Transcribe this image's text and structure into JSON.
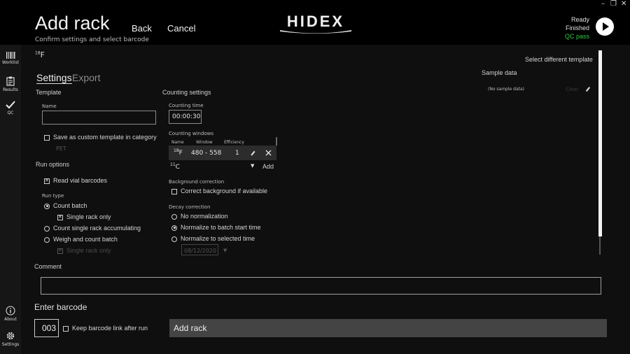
{
  "header": {
    "title": "Add rack",
    "subtitle": "Confirm settings and select barcode",
    "back_label": "Back",
    "cancel_label": "Cancel",
    "logo_text": "HIDEX",
    "status": {
      "ready": "Ready",
      "finished": "Finished",
      "qc": "QC pass",
      "qc_color": "#2ecc40"
    }
  },
  "window_controls": {
    "minimize": "–",
    "restore": "❐",
    "close": "✕"
  },
  "sidebar": {
    "items": [
      {
        "label": "Worklist",
        "icon": "barcode-icon"
      },
      {
        "label": "Results",
        "icon": "clipboard-icon"
      },
      {
        "label": "QC",
        "icon": "check-icon"
      },
      {
        "label": "About",
        "icon": "info-icon"
      },
      {
        "label": "Settings",
        "icon": "gear-icon"
      }
    ]
  },
  "isotope": {
    "mass": "18",
    "symbol": "F"
  },
  "tabs": {
    "settings": "Settings",
    "export": "Export"
  },
  "template": {
    "section": "Template",
    "name_label": "Name",
    "name_value": "",
    "save_custom_label": "Save as custom template in category",
    "save_custom_checked": false,
    "category": "PET"
  },
  "run_options": {
    "section": "Run options",
    "read_vial_barcodes": "Read vial barcodes",
    "run_type_label": "Run type",
    "count_batch": "Count batch",
    "single_rack_only": "Single rack only",
    "count_single_accumulating": "Count single rack accumulating",
    "weigh_and_count": "Weigh and count batch",
    "single_rack_only_2": "Single rack only"
  },
  "counting": {
    "section": "Counting settings",
    "time_label": "Counting time",
    "time_value": "00:00:30",
    "windows_label": "Counting windows",
    "col_name": "Name",
    "col_window": "Window",
    "col_efficiency": "Efficiency",
    "row": {
      "mass": "18",
      "symbol": "F",
      "window": "480 - 558",
      "efficiency": "1"
    },
    "new_isotope": {
      "mass": "11",
      "symbol": "C"
    },
    "add_label": "Add"
  },
  "background": {
    "section": "Background correction",
    "correct_label": "Correct background if available"
  },
  "decay": {
    "section": "Decay correction",
    "none": "No normalization",
    "batch_start": "Normalize to batch start time",
    "selected_time": "Normalize to selected time",
    "date": "08/12/2020"
  },
  "sample_data": {
    "select_template": "Select different template",
    "title": "Sample data",
    "none": "(No sample data)",
    "clear": "Clear"
  },
  "comment": {
    "label": "Comment",
    "value": ""
  },
  "barcode": {
    "label": "Enter barcode",
    "value": "003",
    "keep_link": "Keep barcode link after run",
    "add_rack": "Add rack"
  }
}
